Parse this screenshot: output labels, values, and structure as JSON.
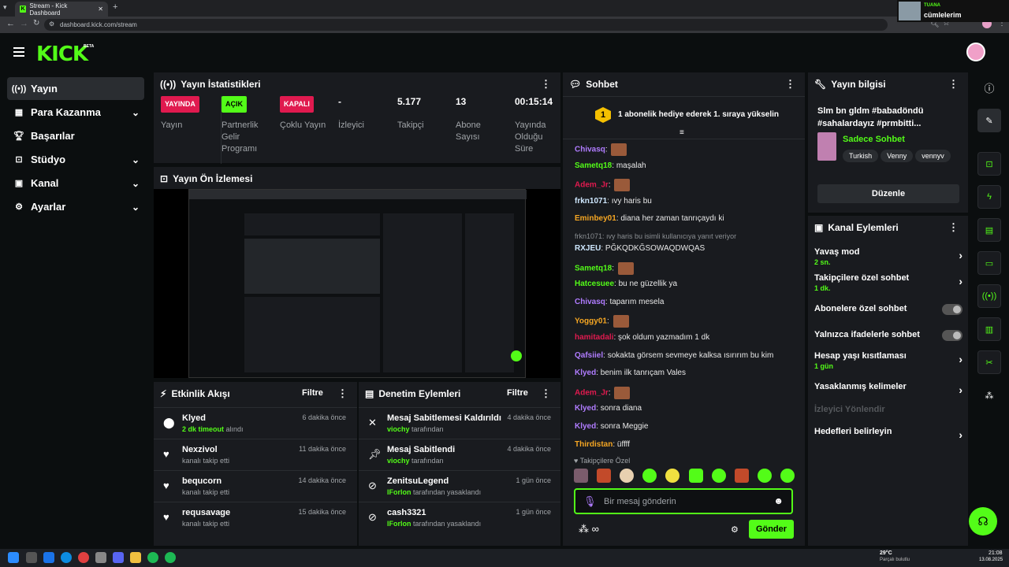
{
  "browser": {
    "tab_title": "Stream - Kick Dashboard",
    "url": "dashboard.kick.com/stream",
    "pip_user": "TUANA",
    "pip_text": "cümlelerim"
  },
  "header": {
    "logo": "KICK",
    "beta": "BETA"
  },
  "sidebar": {
    "items": [
      {
        "label": "Yayın",
        "icon": "broadcast-icon",
        "active": true
      },
      {
        "label": "Para Kazanma",
        "icon": "money-icon",
        "chevron": true
      },
      {
        "label": "Başarılar",
        "icon": "trophy-icon"
      },
      {
        "label": "Stüdyo",
        "icon": "studio-icon",
        "chevron": true
      },
      {
        "label": "Kanal",
        "icon": "channel-icon",
        "chevron": true
      },
      {
        "label": "Ayarlar",
        "icon": "gear-icon",
        "chevron": true
      }
    ]
  },
  "stats": {
    "title": "Yayın İstatistikleri",
    "items": [
      {
        "badge": "YAYINDA",
        "label": "Yayın"
      },
      {
        "badge": "AÇIK",
        "label": "Partnerlik Gelir Programı"
      },
      {
        "badge": "KAPALI",
        "label": "Çoklu Yayın"
      },
      {
        "value": "-",
        "label": "İzleyici"
      },
      {
        "value": "5.177",
        "label": "Takipçi"
      },
      {
        "value": "13",
        "label": "Abone Sayısı"
      },
      {
        "value": "00:15:14",
        "label": "Yayında Olduğu Süre"
      }
    ]
  },
  "preview": {
    "title": "Yayın Ön İzlemesi"
  },
  "activity": {
    "title": "Etkinlik Akışı",
    "filter": "Filtre",
    "items": [
      {
        "name": "Klyed",
        "highlight": "2 dk timeout",
        "desc": "alındı",
        "time": "6 dakika önce"
      },
      {
        "name": "Nexzivol",
        "desc": "kanalı takip etti",
        "time": "11 dakika önce"
      },
      {
        "name": "bequcorn",
        "desc": "kanalı takip etti",
        "time": "14 dakika önce"
      },
      {
        "name": "requsavage",
        "desc": "kanalı takip etti",
        "time": "15 dakika önce"
      }
    ]
  },
  "moderation": {
    "title": "Denetim Eylemleri",
    "filter": "Filtre",
    "items": [
      {
        "name": "Mesaj Sabitlemesi Kaldırıldı",
        "actor": "viochy",
        "desc": "tarafından",
        "time": "4 dakika önce"
      },
      {
        "name": "Mesaj Sabitlendi",
        "actor": "viochy",
        "desc": "tarafından",
        "time": "4 dakika önce"
      },
      {
        "name": "ZenitsuLegend",
        "actor": "IForlon",
        "desc": "tarafından yasaklandı",
        "time": "1 gün önce"
      },
      {
        "name": "cash3321",
        "actor": "IForlon",
        "desc": "tarafından yasaklandı",
        "time": "1 gün önce"
      }
    ]
  },
  "chat": {
    "title": "Sohbet",
    "banner": "1 abonelik hediye ederek 1. sıraya yükselin",
    "banner_rank": "1",
    "messages": [
      {
        "user": "Chivasq",
        "color": "#b07cff",
        "text": ""
      },
      {
        "user": "Sametq18",
        "color": "#53fc18",
        "text": "maşalah"
      },
      {
        "user": "Adem_Jr",
        "color": "#e01a4f",
        "text": ""
      },
      {
        "user": "frkn1071",
        "color": "#cfe8ff",
        "text": "ıvy haris bu"
      },
      {
        "user": "Eminbey01",
        "color": "#f5a623",
        "text": "diana her zaman tanrıçaydı ki"
      },
      {
        "reply": "frkn1071: ıvy haris bu isimli kullanıcıya yanıt veriyor"
      },
      {
        "user": "RXJEU",
        "color": "#cfe8ff",
        "text": "PĞKQDKĞSOWAQDWQAS"
      },
      {
        "user": "Sametq18",
        "color": "#53fc18",
        "text": ""
      },
      {
        "user": "Hatcesuee",
        "color": "#53fc18",
        "text": "bu ne güzellik ya"
      },
      {
        "user": "Chivasq",
        "color": "#b07cff",
        "text": "taparım mesela"
      },
      {
        "user": "Yoggy01",
        "color": "#f5a623",
        "text": ""
      },
      {
        "user": "hamitadali",
        "color": "#e01a4f",
        "text": "şok oldum yazmadım 1 dk"
      },
      {
        "user": "Qafsiiel",
        "color": "#b07cff",
        "text": "sokakta görsem sevmeye kalksa ısırırım bu kim"
      },
      {
        "user": "Klyed",
        "color": "#b07cff",
        "text": "benim ilk tanrıçam Vales"
      },
      {
        "user": "Adem_Jr",
        "color": "#e01a4f",
        "text": ""
      },
      {
        "user": "Klyed",
        "color": "#b07cff",
        "text": "sonra diana"
      },
      {
        "user": "Klyed",
        "color": "#b07cff",
        "text": "sonra Meggie"
      },
      {
        "user": "Thirdistan",
        "color": "#f5a623",
        "text": "üffff"
      }
    ],
    "followers_only": "Takipçilere Özel",
    "input_placeholder": "Bir mesaj gönderin",
    "send": "Gönder"
  },
  "info": {
    "title": "Yayın bilgisi",
    "stream_title": "Slm bn gldm #babadöndü #sahalardayız #prmbitti...",
    "category": "Sadece Sohbet",
    "tags": [
      "Turkish",
      "Venny",
      "vennyv"
    ],
    "edit": "Düzenle"
  },
  "channel_actions": {
    "title": "Kanal Eylemleri",
    "items": [
      {
        "label": "Yavaş mod",
        "sub": "2 sn.",
        "type": "chevron"
      },
      {
        "label": "Takipçilere özel sohbet",
        "sub": "1 dk.",
        "type": "chevron"
      },
      {
        "label": "Abonelere özel sohbet",
        "type": "toggle"
      },
      {
        "label": "Yalnızca ifadelerle sohbet",
        "type": "toggle"
      },
      {
        "label": "Hesap yaşı kısıtlaması",
        "sub": "1 gün",
        "type": "chevron"
      },
      {
        "label": "Yasaklanmış kelimeler",
        "type": "chevron"
      },
      {
        "label": "İzleyici Yönlendir",
        "type": "disabled"
      },
      {
        "label": "Hedefleri belirleyin",
        "type": "chevron"
      }
    ]
  },
  "taskbar": {
    "weather": "29°C",
    "weather_sub": "Parçalı bulutlu",
    "time": "21:08",
    "date": "13.08.2025"
  }
}
